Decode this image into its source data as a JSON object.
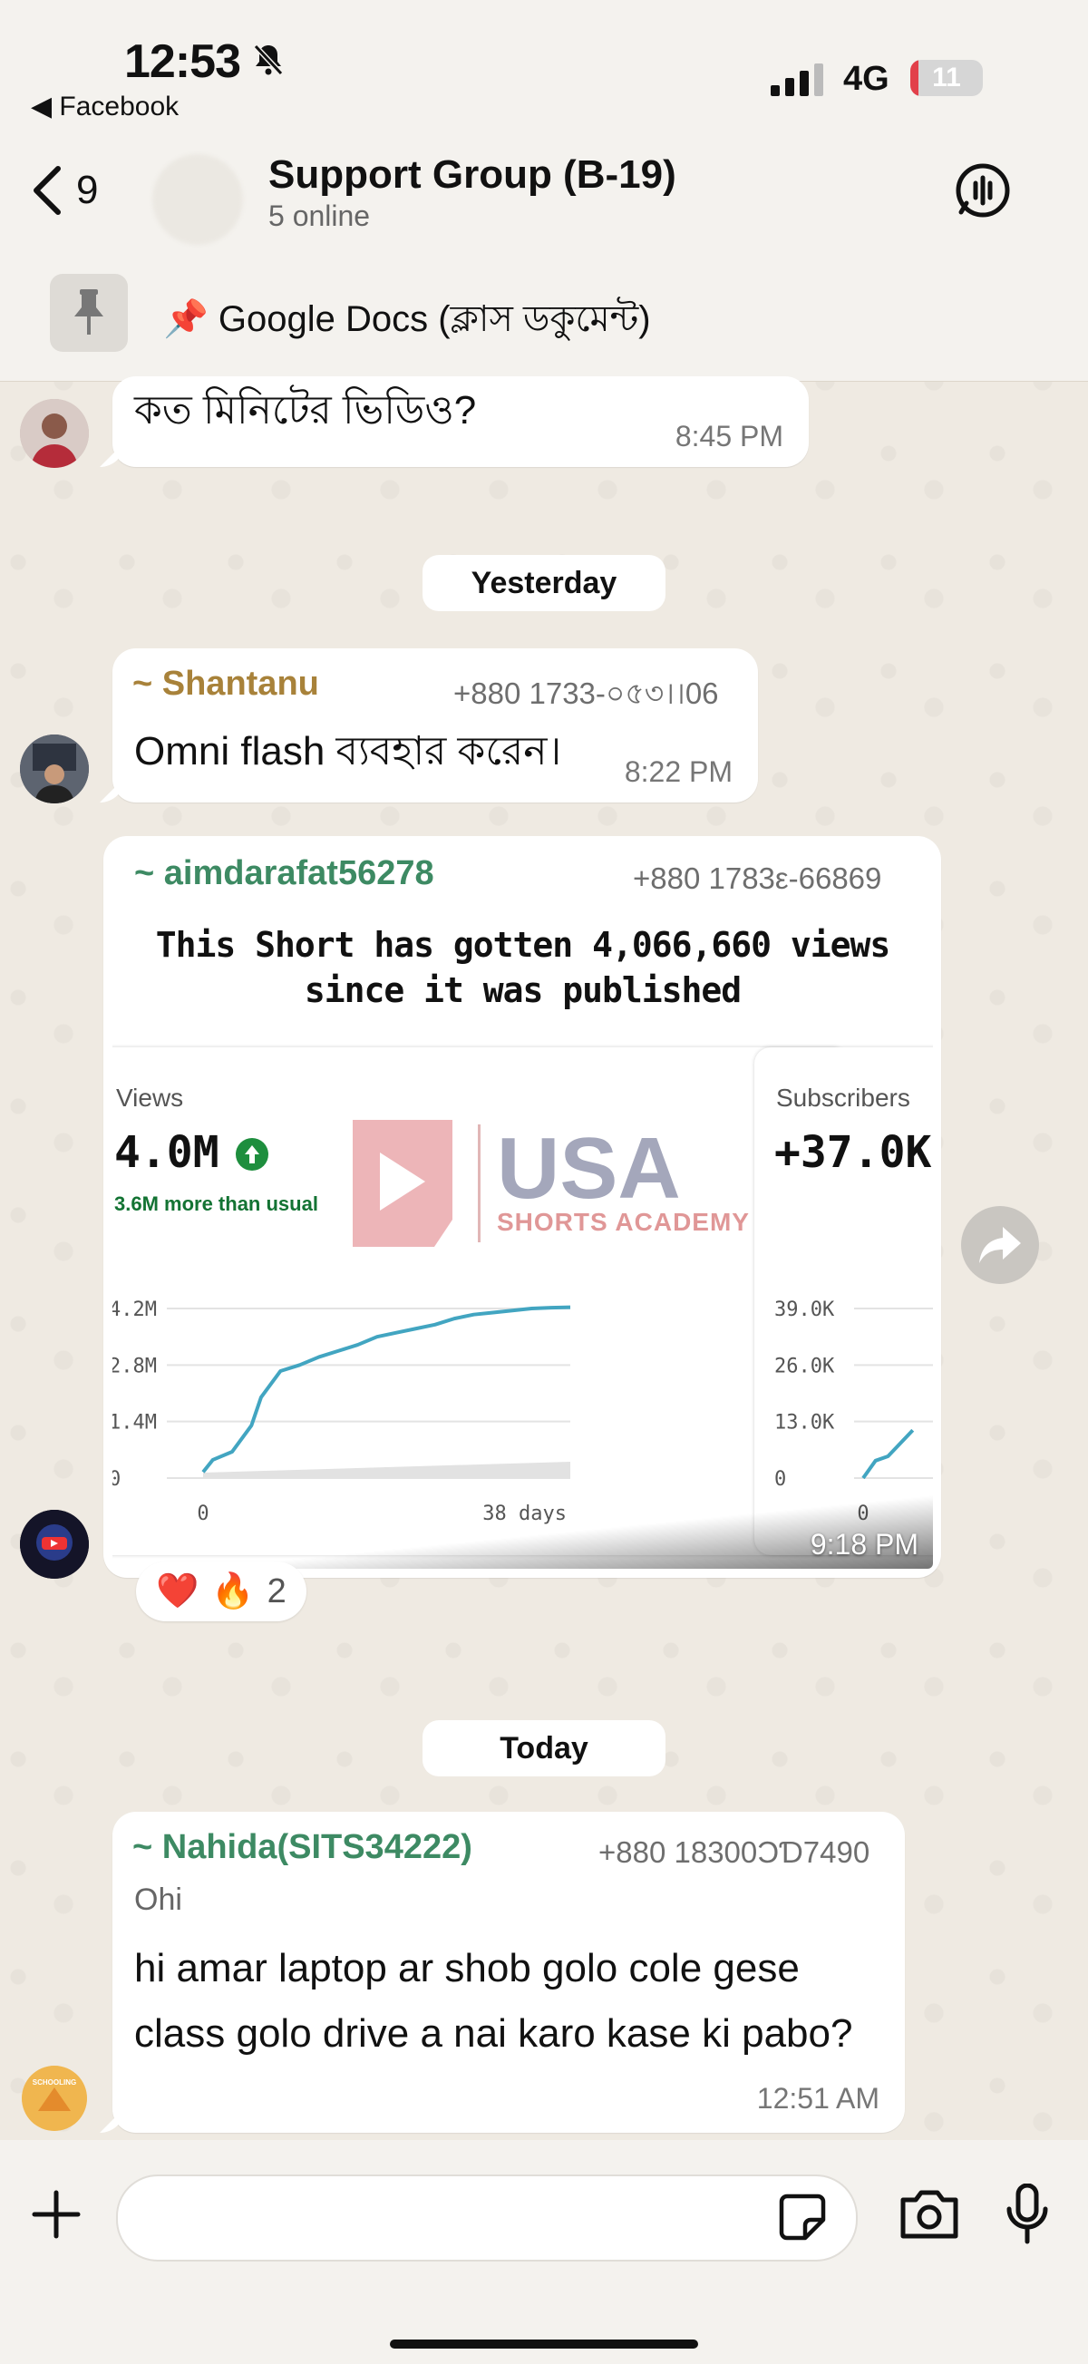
{
  "status_bar": {
    "time": "12:53",
    "back_app": "◀ Facebook",
    "network": "4G",
    "battery": "11",
    "battery_level": 0.11
  },
  "header": {
    "back_count": "9",
    "group_name": "Support Group (B-19)",
    "group_status": "5 online"
  },
  "pinned": {
    "text": "📌 Google Docs (ক্লাস ডকুমেন্ট)"
  },
  "messages": {
    "m1": {
      "text": "কত মিনিটের ভিডিও?",
      "time": "8:45 PM"
    },
    "day1": "Yesterday",
    "m2": {
      "sender": "~ Shantanu",
      "phone": "+880 1733-০৫৩।।06",
      "text": "Omni flash ব্যবহার করেন।",
      "time": "8:22 PM",
      "sender_color": "#a8823a"
    },
    "m3": {
      "sender": "~ aimdarafat56278",
      "phone": "+880 1783ε-66869",
      "sender_color": "#3d8a63",
      "time": "9:18 PM",
      "media_title": "This Short has gotten 4,066,660 views since it was published",
      "watermark": {
        "brand": "USA",
        "sub": "SHORTS ACADEMY"
      },
      "reactions": {
        "emoji1": "❤️",
        "emoji2": "🔥",
        "count": "2"
      }
    },
    "day2": "Today",
    "m4": {
      "sender": "~ Nahida(SITS34222)",
      "phone": "+880 18300ƆƊ7490",
      "sender_color": "#3d8a63",
      "subtitle": "Ohi",
      "line1": "hi amar laptop ar shob golo cole gese",
      "line2": "class golo drive a nai karo kase ki pabo?",
      "time": "12:51 AM"
    },
    "schooling_avatar_label": "SCHOOLING"
  },
  "chart_data": [
    {
      "type": "line",
      "title": "",
      "label": "Views",
      "big_value": "4.0M",
      "note": "3.6M more than usual",
      "y_ticks": [
        "4.2M",
        "2.8M",
        "1.4M",
        "0"
      ],
      "x_ticks": [
        "0",
        "38 days"
      ],
      "ylim": [
        0,
        4200000
      ],
      "xlim": [
        0,
        38
      ],
      "series": [
        {
          "name": "",
          "color": "#42a5c1",
          "x": [
            0,
            1,
            3,
            5,
            6,
            8,
            10,
            12,
            14,
            16,
            18,
            20,
            22,
            24,
            26,
            28,
            30,
            32,
            34,
            36,
            38
          ],
          "y": [
            150000,
            450000,
            650000,
            1300000,
            2000000,
            2650000,
            2800000,
            3000000,
            3150000,
            3300000,
            3500000,
            3600000,
            3700000,
            3800000,
            3950000,
            4050000,
            4100000,
            4150000,
            4200000,
            4220000,
            4230000
          ]
        }
      ]
    },
    {
      "type": "line",
      "title": "",
      "label": "Subscribers",
      "big_value": "+37.0K",
      "y_ticks": [
        "39.0K",
        "26.0K",
        "13.0K",
        "0"
      ],
      "x_ticks": [
        "0"
      ],
      "ylim": [
        0,
        39000
      ],
      "series": [
        {
          "name": "",
          "color": "#42a5c1",
          "x": [
            0,
            2,
            4,
            6,
            8
          ],
          "y": [
            0,
            4000,
            5000,
            8000,
            11000
          ]
        }
      ]
    }
  ]
}
